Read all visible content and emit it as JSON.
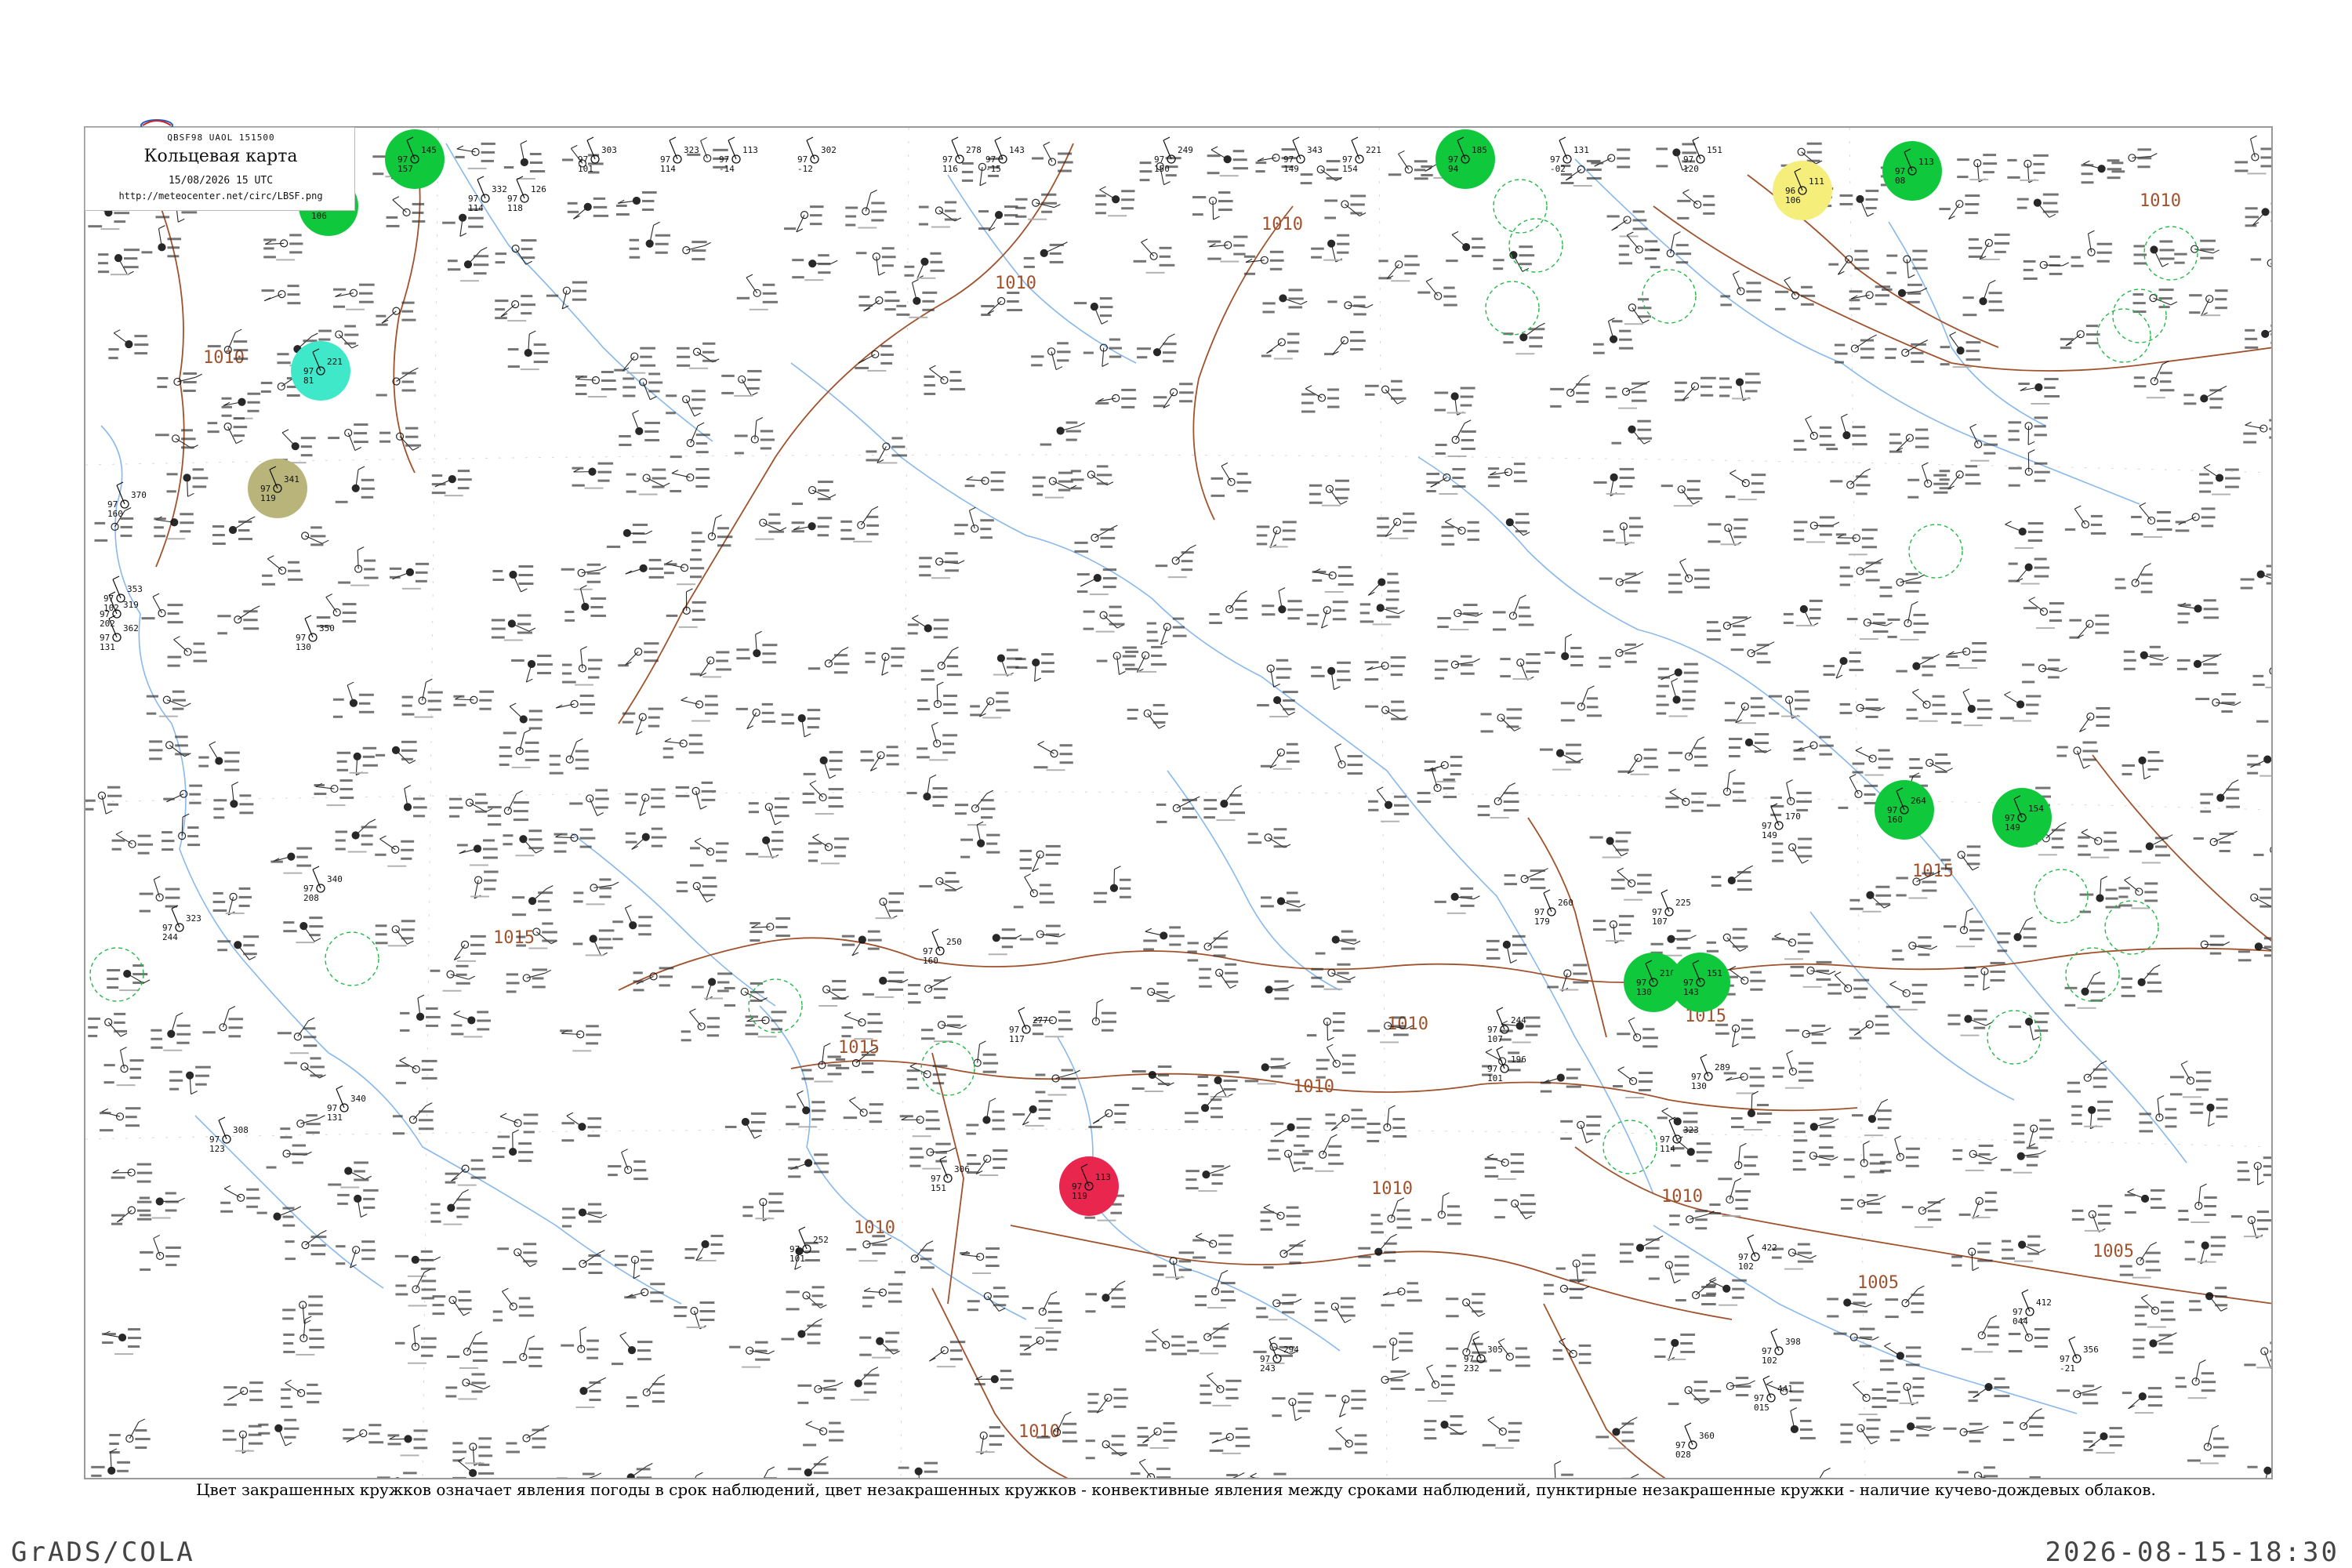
{
  "legend": {
    "code_line": "QBSF98  UAOL  151500",
    "title": "Кольцевая карта",
    "date": "15/08/2026 15 UTC",
    "url": "http://meteocenter.net/circ/LBSF.png"
  },
  "caption": "Цвет закрашенных кружков означает явления погоды в срок наблюдений, цвет незакрашенных кружков - конвективные явления между сроками наблюдений, пунктирные незакрашенные кружки - наличие кучево-дождевых облаков.",
  "footer": {
    "left": "GrADS/COLA",
    "right": "2026-08-15-18:30"
  },
  "colors": {
    "rain": "#10c83c",
    "shower_light": "#3ee8c8",
    "haze": "#b8b47a",
    "fog": "#f6ee7a",
    "thunderstorm": "#e8264e",
    "isobar": "#a0522d",
    "rivers": "#88b8ec",
    "frame": "#9a9a9a"
  },
  "isobar_labels": [
    "1010",
    "1010",
    "1010",
    "1010",
    "1010",
    "1010",
    "1010",
    "1015",
    "1015",
    "1015",
    "1015",
    "1010",
    "1005",
    "1010",
    "1010",
    "1005"
  ],
  "stations": [
    {
      "p": "145",
      "t": "97",
      "td": "157",
      "c": "rain"
    },
    {
      "p": "332",
      "t": "97",
      "td": "114",
      "c": "none"
    },
    {
      "p": "126",
      "t": "97",
      "td": "118",
      "c": "none"
    },
    {
      "p": "303",
      "t": "97",
      "td": "101",
      "c": "none"
    },
    {
      "p": "323",
      "t": "97",
      "td": "114",
      "c": "none"
    },
    {
      "p": "113",
      "t": "97",
      "td": "-14",
      "c": "none"
    },
    {
      "p": "302",
      "t": "97",
      "td": "-12",
      "c": "none"
    },
    {
      "p": "278",
      "t": "97",
      "td": "116",
      "c": "none"
    },
    {
      "p": "143",
      "t": "97",
      "td": "-15",
      "c": "none"
    },
    {
      "p": "249",
      "t": "97",
      "td": "150",
      "c": "none"
    },
    {
      "p": "343",
      "t": "97",
      "td": "149",
      "c": "none"
    },
    {
      "p": "221",
      "t": "97",
      "td": "154",
      "c": "none"
    },
    {
      "p": "185",
      "t": "97",
      "td": "94",
      "c": "rain"
    },
    {
      "p": "131",
      "t": "97",
      "td": "-02",
      "c": "none"
    },
    {
      "p": "151",
      "t": "97",
      "td": "120",
      "c": "none"
    },
    {
      "p": "111",
      "t": "96",
      "td": "106",
      "c": "fog"
    },
    {
      "p": "113",
      "t": "97",
      "td": "08",
      "c": "rain"
    },
    {
      "p": "221",
      "t": "97",
      "td": "81",
      "c": "shower_light"
    },
    {
      "p": "341",
      "t": "97",
      "td": "119",
      "c": "haze"
    },
    {
      "p": "113",
      "t": "97",
      "td": "119",
      "c": "thunderstorm"
    },
    {
      "p": "322",
      "t": "97",
      "td": "106",
      "c": "rain"
    },
    {
      "p": "210",
      "t": "97",
      "td": "130",
      "c": "rain"
    },
    {
      "p": "151",
      "t": "97",
      "td": "143",
      "c": "rain"
    },
    {
      "p": "264",
      "t": "97",
      "td": "160",
      "c": "rain"
    },
    {
      "p": "154",
      "t": "97",
      "td": "149",
      "c": "rain"
    },
    {
      "p": "170",
      "t": "97",
      "td": "149",
      "c": "none"
    },
    {
      "p": "250",
      "t": "97",
      "td": "160",
      "c": "none"
    },
    {
      "p": "225",
      "t": "97",
      "td": "107",
      "c": "none"
    },
    {
      "p": "260",
      "t": "97",
      "td": "179",
      "c": "none"
    },
    {
      "p": "277",
      "t": "97",
      "td": "117",
      "c": "none"
    },
    {
      "p": "306",
      "t": "97",
      "td": "151",
      "c": "none"
    },
    {
      "p": "244",
      "t": "97",
      "td": "107",
      "c": "none"
    },
    {
      "p": "196",
      "t": "97",
      "td": "101",
      "c": "none"
    },
    {
      "p": "289",
      "t": "97",
      "td": "130",
      "c": "none"
    },
    {
      "p": "323",
      "t": "97",
      "td": "114",
      "c": "none"
    },
    {
      "p": "422",
      "t": "97",
      "td": "102",
      "c": "none"
    },
    {
      "p": "398",
      "t": "97",
      "td": "102",
      "c": "none"
    },
    {
      "p": "305",
      "t": "97",
      "td": "232",
      "c": "none"
    },
    {
      "p": "294",
      "t": "97",
      "td": "243",
      "c": "none"
    },
    {
      "p": "412",
      "t": "97",
      "td": "044",
      "c": "none"
    },
    {
      "p": "356",
      "t": "97",
      "td": "-21",
      "c": "none"
    },
    {
      "p": "441",
      "t": "97",
      "td": "015",
      "c": "none"
    },
    {
      "p": "360",
      "t": "97",
      "td": "028",
      "c": "none"
    },
    {
      "p": "308",
      "t": "97",
      "td": "123",
      "c": "none"
    },
    {
      "p": "252",
      "t": "97",
      "td": "101",
      "c": "none"
    },
    {
      "p": "340",
      "t": "97",
      "td": "131",
      "c": "none"
    },
    {
      "p": "340",
      "t": "97",
      "td": "208",
      "c": "none"
    },
    {
      "p": "323",
      "t": "97",
      "td": "244",
      "c": "none"
    },
    {
      "p": "350",
      "t": "97",
      "td": "130",
      "c": "none"
    },
    {
      "p": "370",
      "t": "97",
      "td": "160",
      "c": "none"
    },
    {
      "p": "353",
      "t": "97",
      "td": "102",
      "c": "none"
    },
    {
      "p": "362",
      "t": "97",
      "td": "131",
      "c": "none"
    },
    {
      "p": "319",
      "t": "97",
      "td": "202",
      "c": "none"
    }
  ]
}
